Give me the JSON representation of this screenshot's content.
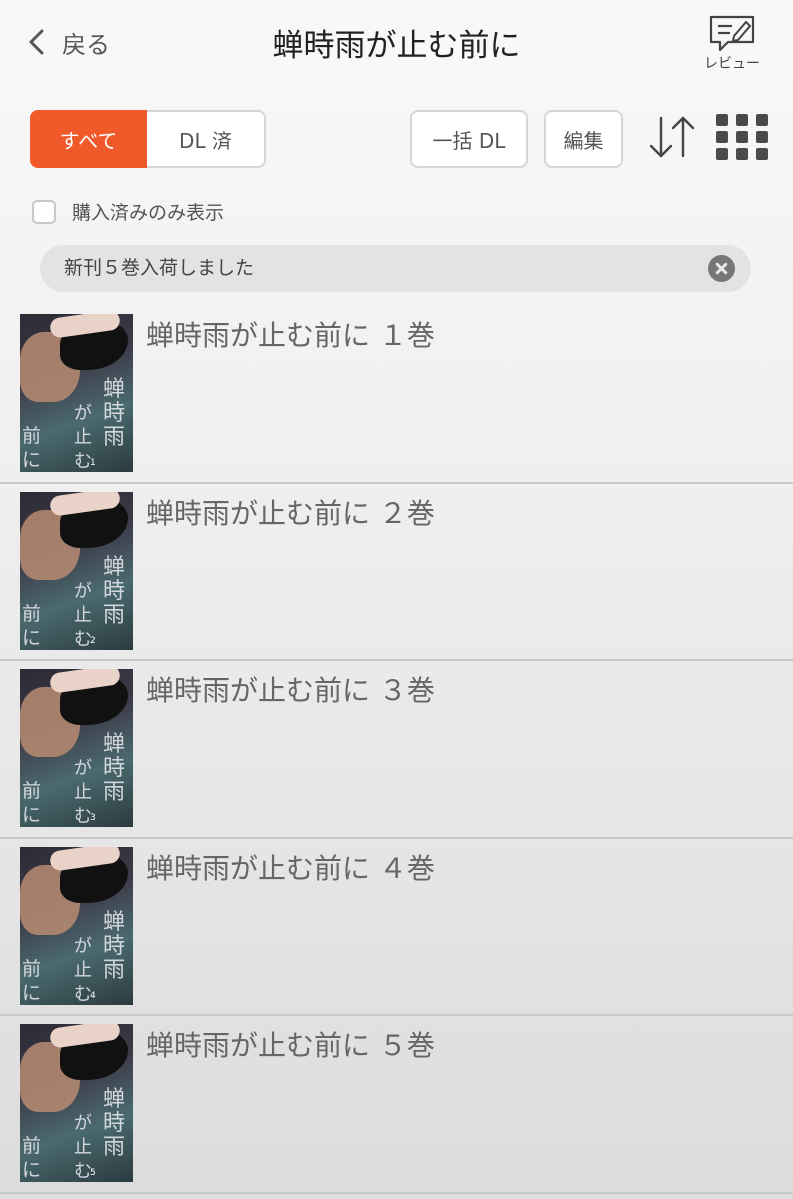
{
  "header": {
    "back_label": "戻る",
    "title": "蝉時雨が止む前に",
    "review_label": "レビュー"
  },
  "toolbar": {
    "tab_all": "すべて",
    "tab_downloaded": "DL 済",
    "bulk_download": "一括 DL",
    "edit": "編集",
    "sort_icon": "sort-arrows-icon",
    "grid_icon": "grid-view-icon",
    "accent_color": "#f05a2a"
  },
  "filter": {
    "purchased_only_label": "購入済みのみ表示",
    "checked": false
  },
  "notice": {
    "text": "新刊５巻入荷しました"
  },
  "cover": {
    "title_chars": "蝉時雨",
    "title_chars_mid": "が止む",
    "title_chars_low": "前に"
  },
  "volumes": [
    {
      "title": "蝉時雨が止む前に １巻",
      "cover_no": "1"
    },
    {
      "title": "蝉時雨が止む前に ２巻",
      "cover_no": "2"
    },
    {
      "title": "蝉時雨が止む前に ３巻",
      "cover_no": "3"
    },
    {
      "title": "蝉時雨が止む前に ４巻",
      "cover_no": "4"
    },
    {
      "title": "蝉時雨が止む前に ５巻",
      "cover_no": "5"
    }
  ]
}
